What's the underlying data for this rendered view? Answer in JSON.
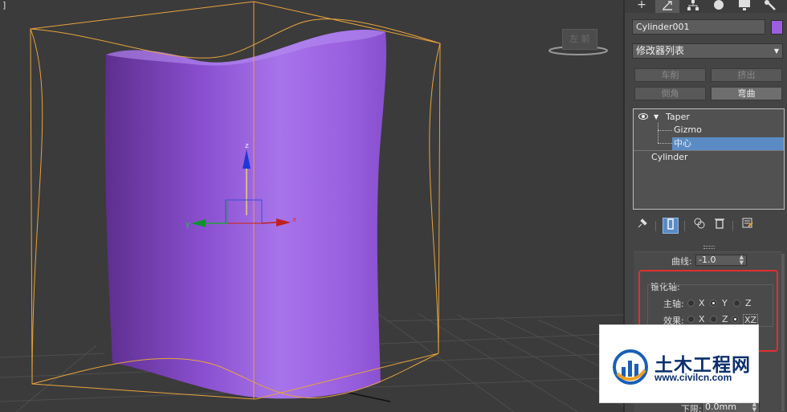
{
  "viewport": {
    "label": "]",
    "viewcube_label": "左 前",
    "gizmo_axes": {
      "x": "x",
      "y": "y",
      "z": "z"
    }
  },
  "command_panel": {
    "tabs": [
      "+",
      "modify",
      "hierarchy",
      "motion",
      "display",
      "utilities"
    ],
    "object_name": "Cylinder001",
    "object_color": "#9c5ee0",
    "modifier_list": "修改器列表",
    "quick_buttons": [
      "车削",
      "挤出",
      "倒角",
      "弯曲"
    ],
    "stack": {
      "items": [
        {
          "label": "Taper"
        },
        {
          "label": "Gizmo"
        },
        {
          "label": "中心",
          "selected": true
        },
        {
          "label": "Cylinder"
        }
      ]
    },
    "params": {
      "curve_label": "曲线:",
      "curve_value": "-1.0",
      "taper_axis_label": "锥化轴:",
      "primary_label": "主轴:",
      "primary_options": [
        "X",
        "Y",
        "Z"
      ],
      "primary_selected": "Y",
      "effect_label": "效果:",
      "effect_options": [
        "X",
        "Z",
        "XZ"
      ],
      "effect_selected": "XZ",
      "lower_limit_label": "下限:",
      "lower_limit_value": "0.0mm"
    }
  },
  "watermark": {
    "name": "土木工程网",
    "url": "www.civilcn.com"
  },
  "colors": {
    "object": "#9c5ee0",
    "selection_box": "#e8a33c",
    "highlight": "#e03030",
    "stack_selected": "#5b8bc4"
  }
}
